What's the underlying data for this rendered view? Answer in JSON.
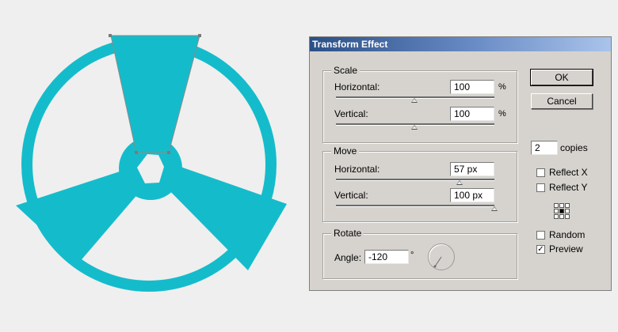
{
  "art": {
    "fill_color": "#14bccb",
    "selection_color": "#8a8a8a"
  },
  "dialog": {
    "title": "Transform Effect",
    "scale": {
      "title": "Scale",
      "horizontal_label": "Horizontal:",
      "horizontal_value": "100",
      "horizontal_unit": "%",
      "vertical_label": "Vertical:",
      "vertical_value": "100",
      "vertical_unit": "%"
    },
    "move": {
      "title": "Move",
      "horizontal_label": "Horizontal:",
      "horizontal_value": "57 px",
      "vertical_label": "Vertical:",
      "vertical_value": "100 px"
    },
    "rotate": {
      "title": "Rotate",
      "angle_label": "Angle:",
      "angle_value": "-120",
      "angle_unit": "°"
    },
    "buttons": {
      "ok": "OK",
      "cancel": "Cancel"
    },
    "copies": {
      "value": "2",
      "label": "copies"
    },
    "options": {
      "reflect_x": {
        "label": "Reflect X",
        "checked": false
      },
      "reflect_y": {
        "label": "Reflect Y",
        "checked": false
      },
      "random": {
        "label": "Random",
        "checked": false
      },
      "preview": {
        "label": "Preview",
        "checked": true
      }
    },
    "check_glyph": "✓"
  }
}
